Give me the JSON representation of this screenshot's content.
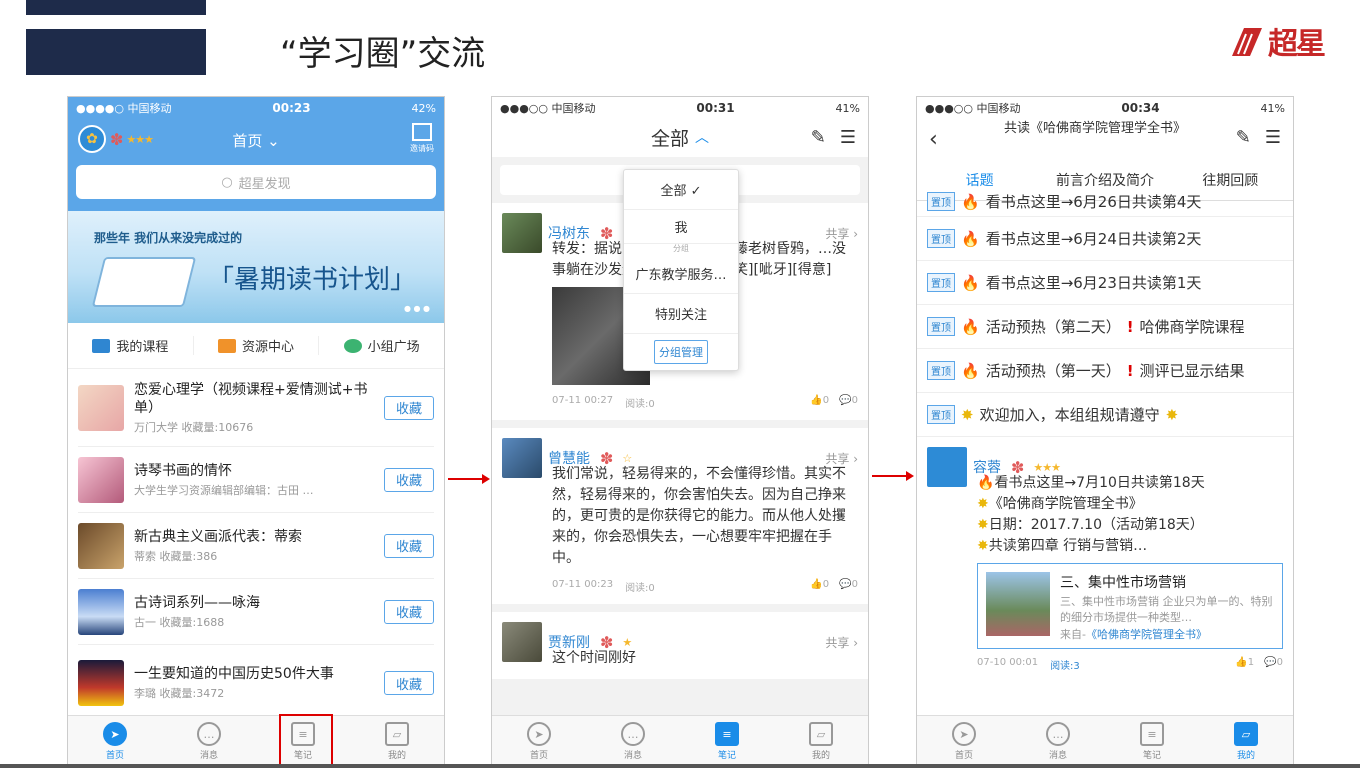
{
  "slide": {
    "title": "“学习圈”交流",
    "logo_text": "超星"
  },
  "phone1": {
    "status": {
      "carrier": "●●●●○ 中国移动",
      "time": "00:23",
      "battery": "42%"
    },
    "nav_title": "首页",
    "qr_label": "邀请码",
    "search_placeholder": "超星发现",
    "banner": {
      "sub": "那些年  我们从来没完成过的",
      "main": "「暑期读书计划」"
    },
    "quick_links": [
      "我的课程",
      "资源中心",
      "小组广场"
    ],
    "courses": [
      {
        "title": "恋爱心理学（视频课程+爱情测试+书单）",
        "meta": "万门大学    收藏量:10676"
      },
      {
        "title": "诗琴书画的情怀",
        "meta": "大学生学习资源编辑部编辑：古田 …"
      },
      {
        "title": "新古典主义画派代表：蒂索",
        "meta": "蒂索    收藏量:386"
      },
      {
        "title": "古诗词系列——咏海",
        "meta": "古一    收藏量:1688"
      },
      {
        "title": "一生要知道的中国历史50件大事",
        "meta": "李璐    收藏量:3472"
      }
    ],
    "fav_label": "收藏",
    "tabs": [
      "首页",
      "消息",
      "笔记",
      "我的"
    ]
  },
  "phone2": {
    "status": {
      "carrier": "●●●○○ 中国移动",
      "time": "00:31",
      "battery": "41%"
    },
    "nav_title": "全部",
    "dropdown": {
      "items": [
        "全部 ✓",
        "我"
      ],
      "group_label": "分组",
      "groups": [
        "广东教学服务…",
        "特别关注"
      ],
      "manage": "分组管理"
    },
    "posts": [
      {
        "name": "冯树东",
        "text": "转发：据说…天是这样的：枯藤老树昏鸦，…没事躺在沙发遥控一拿，过水…笑][呲牙][得意]",
        "time": "07-11 00:27",
        "read": "阅读:0",
        "likes": "0",
        "comments": "0"
      },
      {
        "name": "曾慧能",
        "text": "我们常说，轻易得来的，不会懂得珍惜。其实不然，轻易得来的，你会害怕失去。因为自己挣来的，更可贵的是你获得它的能力。而从他人处攫来的，你会恐惧失去，一心想要牢牢把握在手中。",
        "time": "07-11 00:23",
        "read": "阅读:0",
        "likes": "0",
        "comments": "0"
      },
      {
        "name": "贾新刚",
        "text": "这个时间刚好"
      }
    ],
    "share_label": "共享",
    "tabs": [
      "首页",
      "消息",
      "笔记",
      "我的"
    ]
  },
  "phone3": {
    "status": {
      "carrier": "●●●○○ 中国移动",
      "time": "00:34",
      "battery": "41%"
    },
    "nav_title": "共读《哈佛商学院管理学全书》",
    "tabs_top": [
      "话题",
      "前言介绍及简介",
      "往期回顾"
    ],
    "pin_tag": "置顶",
    "pins": [
      "看书点这里→6月26日共读第4天",
      "看书点这里→6月24日共读第2天",
      "看书点这里→6月23日共读第1天",
      "活动预热（第二天）",
      "活动预热（第一天）",
      "欢迎加入，本组组规请遵守"
    ],
    "pin_suffix": [
      "",
      "",
      "",
      "哈佛商学院课程",
      "测评已显示结果",
      ""
    ],
    "post": {
      "name": "容蓉",
      "lines": [
        "看书点这里→7月10日共读第18天",
        "《哈佛商学院管理全书》",
        "日期：2017.7.10（活动第18天）",
        "共读第四章 行销与营销…"
      ],
      "card_title": "三、集中性市场营销",
      "card_desc": "三、集中性市场营销 企业只为单一的、特别的细分市场提供一种类型…",
      "card_src_prefix": "来自-",
      "card_src": "《哈佛商学院管理全书》",
      "time": "07-10 00:01",
      "read": "阅读:3",
      "likes": "1",
      "comments": "0"
    },
    "tabs": [
      "首页",
      "消息",
      "笔记",
      "我的"
    ]
  },
  "colors": {
    "accent": "#1a8ce8",
    "navy": "#1e2b4a",
    "red": "#d00"
  }
}
